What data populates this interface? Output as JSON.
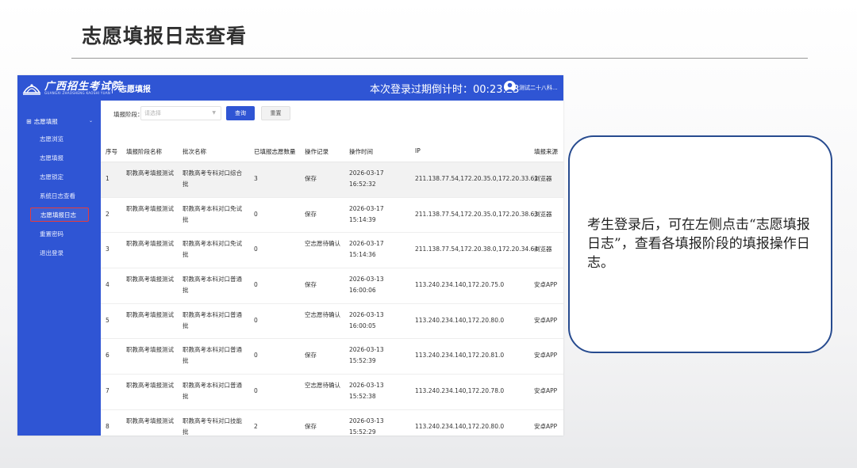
{
  "slide": {
    "title": "志愿填报日志查看",
    "callout_text": "考生登录后，可在左侧点击“志愿填报日志”，查看各填报阶段的填报操作日志。"
  },
  "app": {
    "logo_text": "广西招生考试院",
    "logo_sub": "GUANGXI ZHAOSHENG KAOSHI YUAN",
    "system_title": "志愿填报",
    "countdown_label": "本次登录过期倒计时：",
    "countdown_value": "00:23:23",
    "username": "测试二十八科..."
  },
  "sidebar": {
    "group_label": "志愿填报",
    "items": [
      {
        "label": "志愿浏览"
      },
      {
        "label": "志愿填报"
      },
      {
        "label": "志愿锁定"
      },
      {
        "label": "系统日志查看"
      },
      {
        "label": "志愿填报日志",
        "active": true
      },
      {
        "label": "重置密码"
      },
      {
        "label": "退出登录"
      }
    ]
  },
  "filter": {
    "label": "填报阶段：",
    "placeholder": "请选择",
    "query_button": "查询",
    "reset_button": "重置"
  },
  "table": {
    "headers": [
      "序号",
      "填报阶段名称",
      "批次名称",
      "已填报志愿数量",
      "操作记录",
      "操作时间",
      "IP",
      "填报来源"
    ],
    "rows": [
      {
        "no": "1",
        "stage": "职教高考填报测试",
        "batch": "职教高考专科对口综合批",
        "count": "3",
        "action": "保存",
        "time": "2026-03-17 16:52:32",
        "ip": "211.138.77.54,172.20.35.0,172.20.33.61",
        "source": "浏览器"
      },
      {
        "no": "2",
        "stage": "职教高考填报测试",
        "batch": "职教高考本科对口免试批",
        "count": "0",
        "action": "保存",
        "time": "2026-03-17 15:14:39",
        "ip": "211.138.77.54,172.20.35.0,172.20.38.63",
        "source": "浏览器"
      },
      {
        "no": "3",
        "stage": "职教高考填报测试",
        "batch": "职教高考本科对口免试批",
        "count": "0",
        "action": "空志愿待确认",
        "time": "2026-03-17 15:14:36",
        "ip": "211.138.77.54,172.20.38.0,172.20.34.64",
        "source": "浏览器"
      },
      {
        "no": "4",
        "stage": "职教高考填报测试",
        "batch": "职教高考本科对口普通批",
        "count": "0",
        "action": "保存",
        "time": "2026-03-13 16:00:06",
        "ip": "113.240.234.140,172.20.75.0",
        "source": "安卓APP"
      },
      {
        "no": "5",
        "stage": "职教高考填报测试",
        "batch": "职教高考本科对口普通批",
        "count": "0",
        "action": "空志愿待确认",
        "time": "2026-03-13 16:00:05",
        "ip": "113.240.234.140,172.20.80.0",
        "source": "安卓APP"
      },
      {
        "no": "6",
        "stage": "职教高考填报测试",
        "batch": "职教高考本科对口普通批",
        "count": "0",
        "action": "保存",
        "time": "2026-03-13 15:52:39",
        "ip": "113.240.234.140,172.20.81.0",
        "source": "安卓APP"
      },
      {
        "no": "7",
        "stage": "职教高考填报测试",
        "batch": "职教高考本科对口普通批",
        "count": "0",
        "action": "空志愿待确认",
        "time": "2026-03-13 15:52:38",
        "ip": "113.240.234.140,172.20.78.0",
        "source": "安卓APP"
      },
      {
        "no": "8",
        "stage": "职教高考填报测试",
        "batch": "职教高考专科对口技能批",
        "count": "2",
        "action": "保存",
        "time": "2026-03-13 15:52:29",
        "ip": "113.240.234.140,172.20.80.0",
        "source": "安卓APP"
      }
    ]
  },
  "colors": {
    "primary": "#2f55d4",
    "highlight_border": "#e83b3b",
    "callout_border": "#274b8f"
  }
}
